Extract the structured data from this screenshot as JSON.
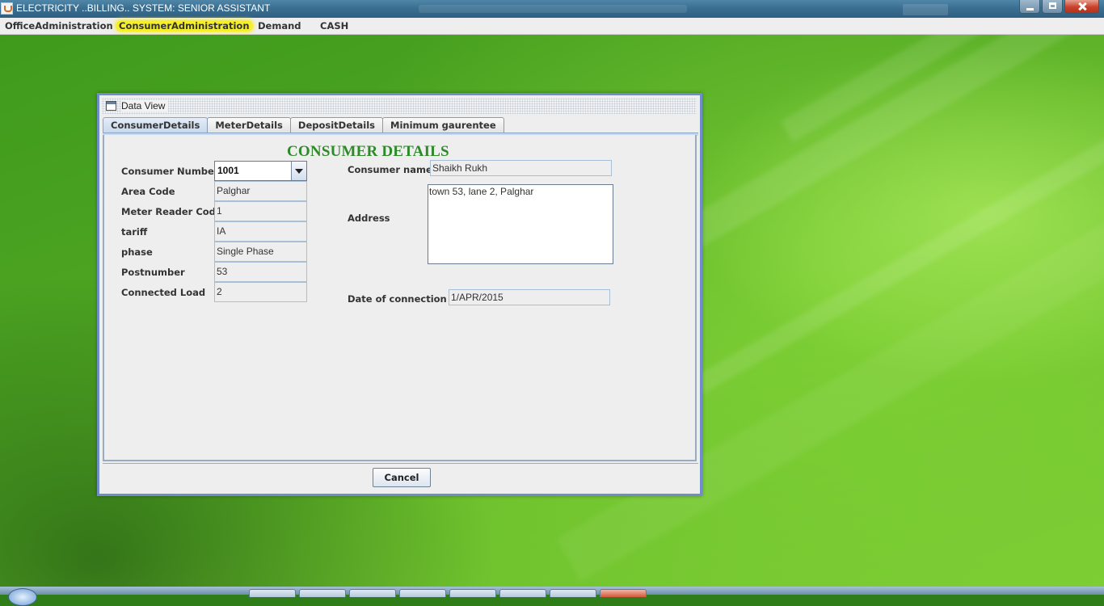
{
  "window": {
    "title": "ELECTRICITY ..BILLING.. SYSTEM: SENIOR ASSISTANT"
  },
  "menu": [
    {
      "label": "OfficeAdministration",
      "highlighted": false
    },
    {
      "label": "ConsumerAdministration",
      "highlighted": true
    },
    {
      "label": "Demand",
      "highlighted": false
    },
    {
      "label": "CASH",
      "highlighted": false
    }
  ],
  "dialog": {
    "title": "Data View",
    "tabs": [
      {
        "label": "ConsumerDetails",
        "active": true
      },
      {
        "label": "MeterDetails",
        "active": false
      },
      {
        "label": "DepositDetails",
        "active": false
      },
      {
        "label": "Minimum gaurentee",
        "active": false
      }
    ],
    "heading": "CONSUMER DETAILS",
    "left_fields": {
      "consumer_number": {
        "label": "Consumer Number",
        "value": "1001"
      },
      "area_code": {
        "label": "Area Code",
        "value": "Palghar"
      },
      "meter_reader_code": {
        "label": "Meter Reader Code",
        "value": "1"
      },
      "tariff": {
        "label": "tariff",
        "value": "IA"
      },
      "phase": {
        "label": "phase",
        "value": "Single Phase"
      },
      "postnumber": {
        "label": "Postnumber",
        "value": "53"
      },
      "connected_load": {
        "label": "Connected Load",
        "value": "2"
      }
    },
    "right_fields": {
      "consumer_name": {
        "label": "Consumer name",
        "value": "Shaikh Rukh"
      },
      "address": {
        "label": "Address",
        "value": "town 53, lane 2, Palghar"
      },
      "date_of_connection": {
        "label": "Date of connection",
        "value": "1/APR/2015"
      }
    },
    "cancel_label": "Cancel"
  },
  "colors": {
    "heading": "#2d8a28",
    "menu_highlight": "#f5ee2a",
    "dialog_border": "#6f8ec9",
    "desktop_green": "#5fb42a"
  }
}
